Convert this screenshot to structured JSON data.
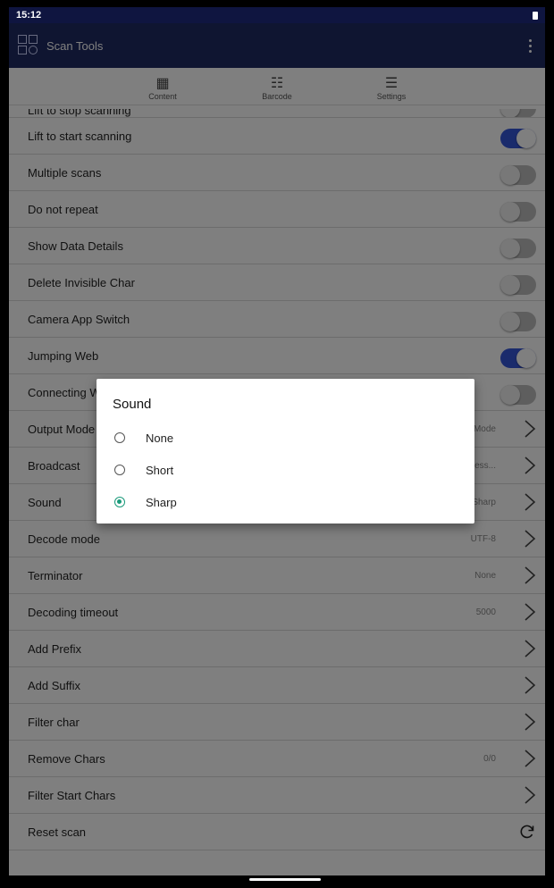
{
  "status": {
    "time": "15:12"
  },
  "appbar": {
    "title": "Scan Tools"
  },
  "tabs": [
    {
      "label": "Content",
      "icon": "content-icon"
    },
    {
      "label": "Barcode",
      "icon": "barcode-icon"
    },
    {
      "label": "Settings",
      "icon": "settings-icon"
    }
  ],
  "settings": [
    {
      "label": "Lift to stop scanning",
      "kind": "toggle",
      "on": false
    },
    {
      "label": "Lift to start scanning",
      "kind": "toggle",
      "on": true
    },
    {
      "label": "Multiple scans",
      "kind": "toggle",
      "on": false
    },
    {
      "label": "Do not repeat",
      "kind": "toggle",
      "on": false
    },
    {
      "label": "Show Data Details",
      "kind": "toggle",
      "on": false
    },
    {
      "label": "Delete Invisible Char",
      "kind": "toggle",
      "on": false
    },
    {
      "label": "Camera App Switch",
      "kind": "toggle",
      "on": false
    },
    {
      "label": "Jumping Web",
      "kind": "toggle",
      "on": true
    },
    {
      "label": "Connecting W",
      "kind": "toggle",
      "on": false
    },
    {
      "label": "Output Mode",
      "kind": "nav",
      "value": "st Mode"
    },
    {
      "label": "Broadcast",
      "kind": "nav",
      "value": "mess..."
    },
    {
      "label": "Sound",
      "kind": "nav",
      "value": "Sharp"
    },
    {
      "label": "Decode mode",
      "kind": "nav",
      "value": "UTF-8"
    },
    {
      "label": "Terminator",
      "kind": "nav",
      "value": "None"
    },
    {
      "label": "Decoding timeout",
      "kind": "nav",
      "value": "5000"
    },
    {
      "label": "Add Prefix",
      "kind": "nav",
      "value": ""
    },
    {
      "label": "Add Suffix",
      "kind": "nav",
      "value": ""
    },
    {
      "label": "Filter char",
      "kind": "nav",
      "value": ""
    },
    {
      "label": "Remove Chars",
      "kind": "nav",
      "value": "0/0"
    },
    {
      "label": "Filter Start Chars",
      "kind": "nav",
      "value": ""
    },
    {
      "label": "Reset scan",
      "kind": "reset",
      "value": ""
    }
  ],
  "dialog": {
    "title": "Sound",
    "options": [
      {
        "label": "None",
        "selected": false
      },
      {
        "label": "Short",
        "selected": false
      },
      {
        "label": "Sharp",
        "selected": true
      }
    ]
  },
  "colors": {
    "appbar": "#1f2a63",
    "toggle_on": "#3556d9",
    "radio_selected": "#1a9a7a"
  }
}
